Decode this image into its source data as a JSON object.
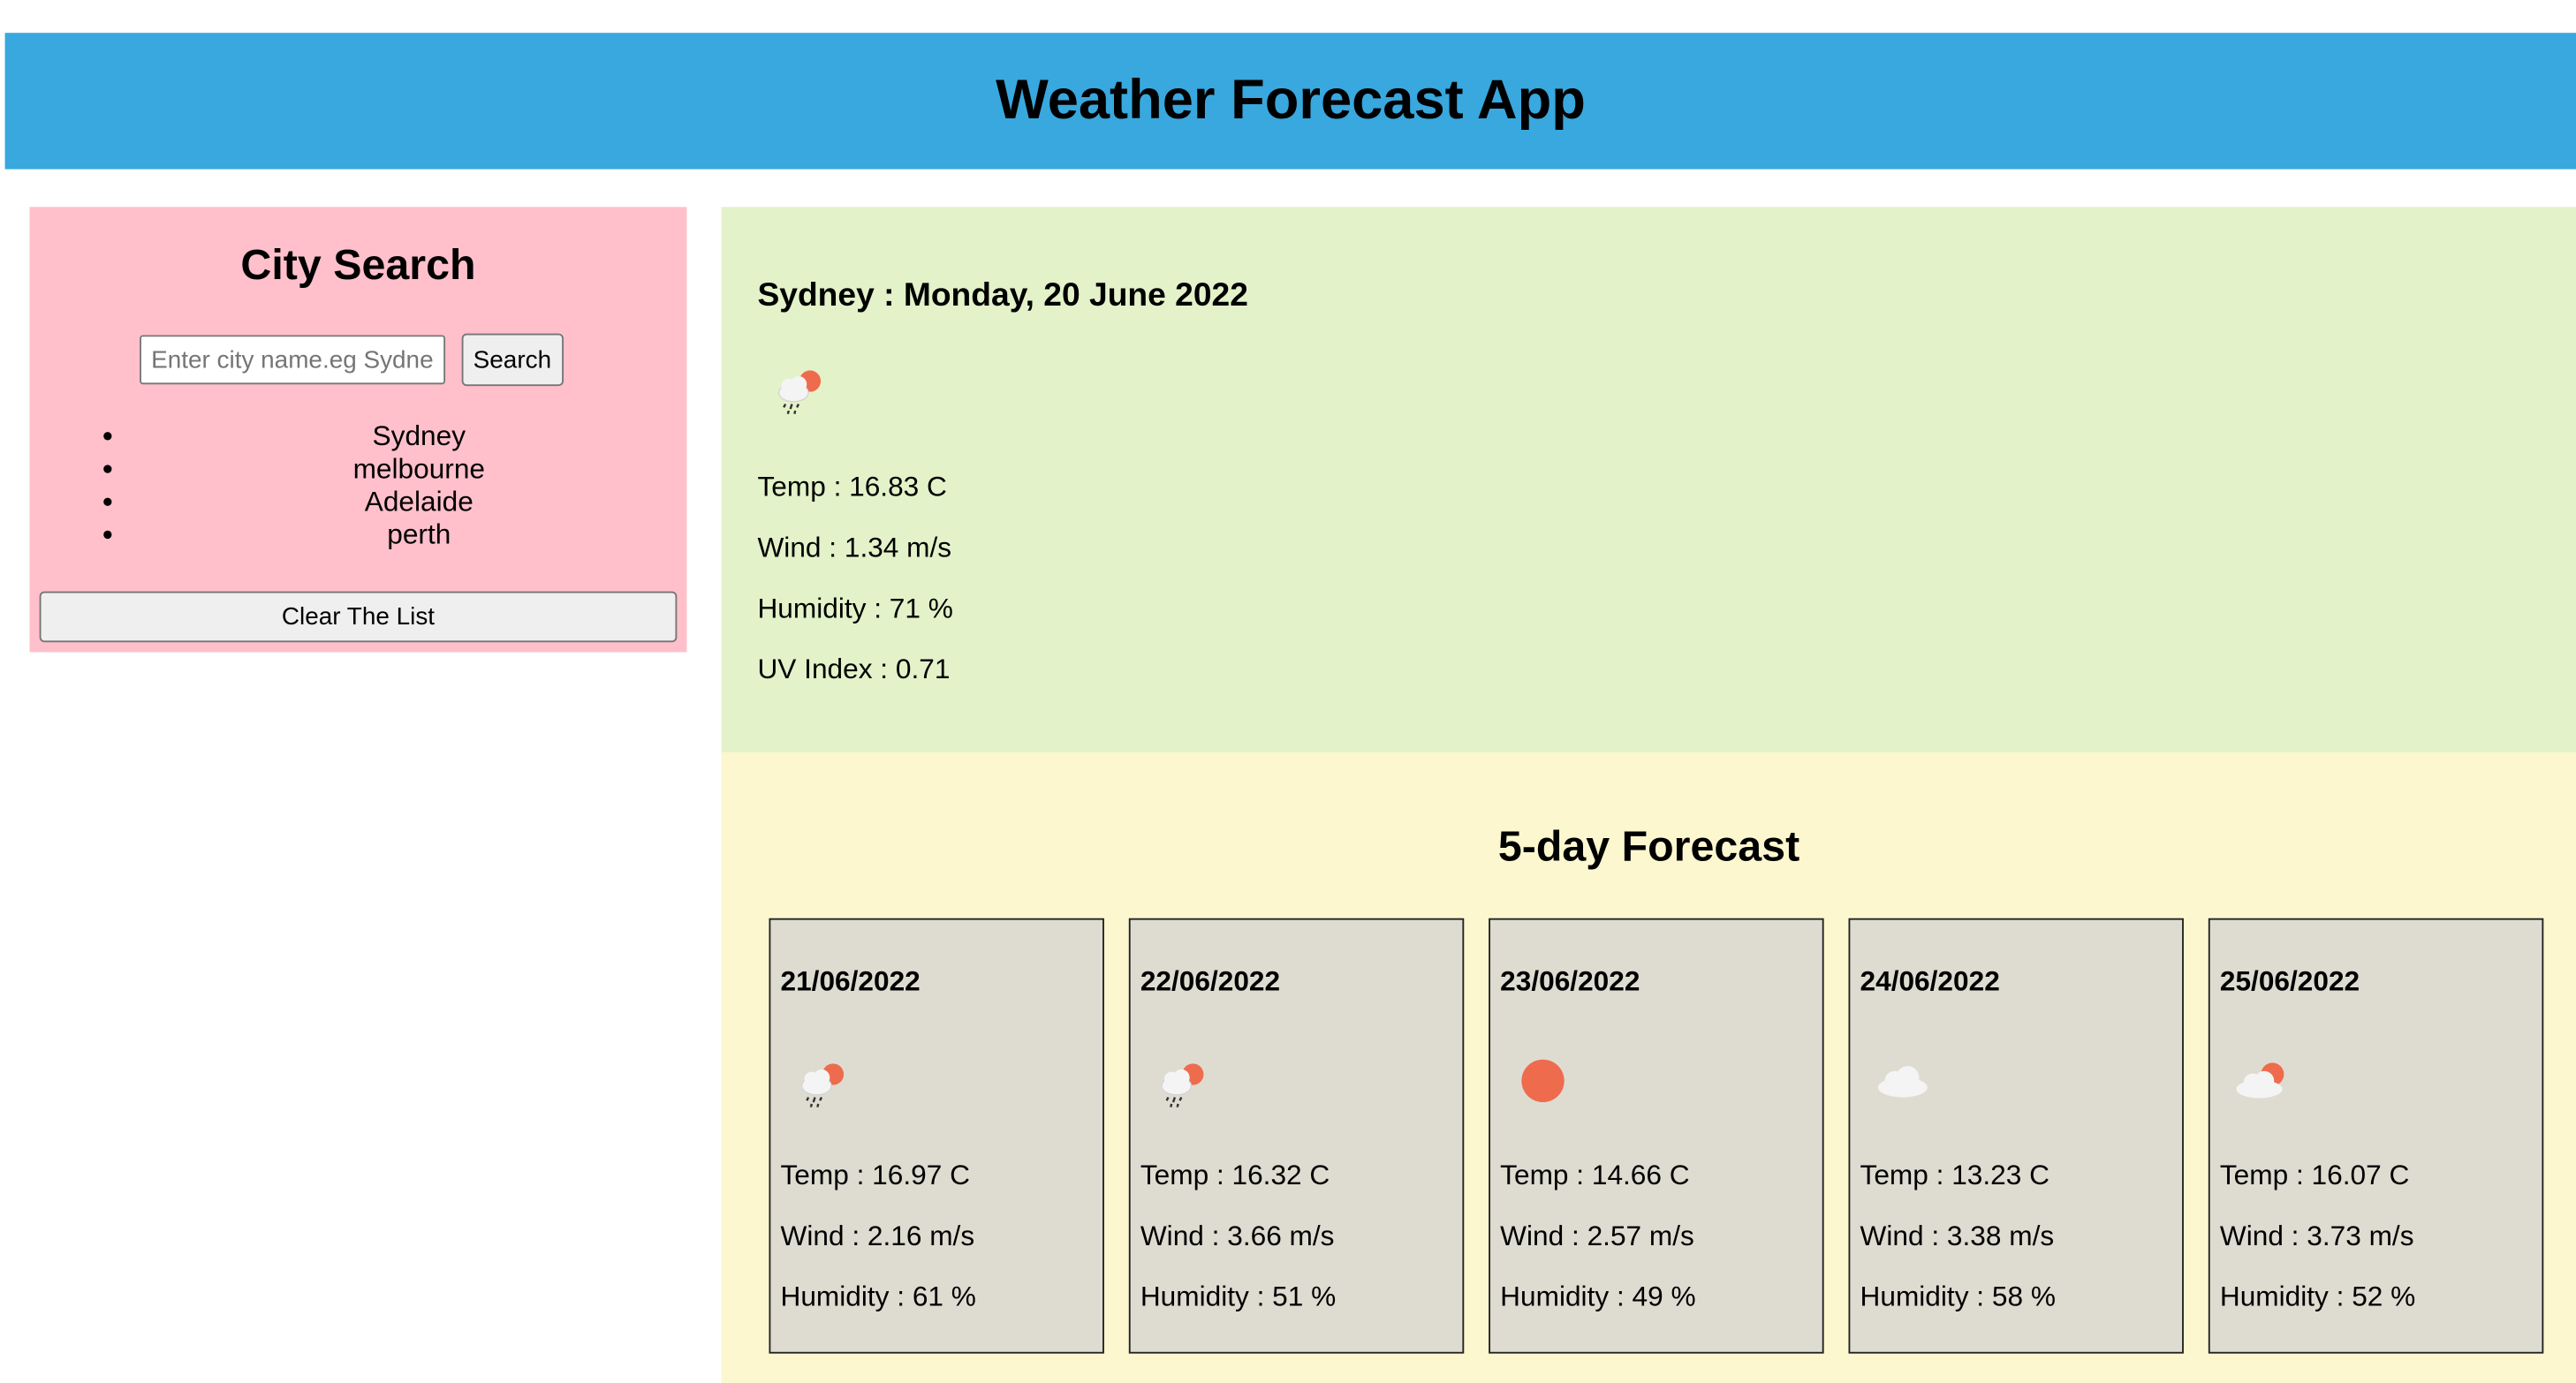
{
  "header": {
    "title": "Weather Forecast App"
  },
  "city_search": {
    "title": "City Search",
    "input_placeholder": "Enter city name.eg Sydney",
    "input_value": "",
    "search_label": "Search",
    "history": [
      "Sydney",
      "melbourne",
      "Adelaide",
      "perth"
    ],
    "clear_label": "Clear The List"
  },
  "current": {
    "title": "Sydney : Monday, 20 June 2022",
    "icon": "rain-sun-icon",
    "temp": "Temp : 16.83 C",
    "wind": "Wind : 1.34 m/s",
    "humidity": "Humidity : 71 %",
    "uv": "UV Index : 0.71"
  },
  "forecast": {
    "title": "5-day Forecast",
    "days": [
      {
        "date": "21/06/2022",
        "icon": "rain-sun-icon",
        "temp": "Temp : 16.97 C",
        "wind": "Wind : 2.16 m/s",
        "humidity": "Humidity : 61 %"
      },
      {
        "date": "22/06/2022",
        "icon": "rain-sun-icon",
        "temp": "Temp : 16.32 C",
        "wind": "Wind : 3.66 m/s",
        "humidity": "Humidity : 51 %"
      },
      {
        "date": "23/06/2022",
        "icon": "sun-icon",
        "temp": "Temp : 14.66 C",
        "wind": "Wind : 2.57 m/s",
        "humidity": "Humidity : 49 %"
      },
      {
        "date": "24/06/2022",
        "icon": "cloud-icon",
        "temp": "Temp : 13.23 C",
        "wind": "Wind : 3.38 m/s",
        "humidity": "Humidity : 58 %"
      },
      {
        "date": "25/06/2022",
        "icon": "cloud-sun-icon",
        "temp": "Temp : 16.07 C",
        "wind": "Wind : 3.73 m/s",
        "humidity": "Humidity : 52 %"
      }
    ]
  },
  "colors": {
    "header_bg": "#38a8df",
    "search_panel_bg": "#ffc0cb",
    "current_panel_bg": "#e3f2c9",
    "forecast_panel_bg": "#fcf7cf",
    "card_bg": "#dedcd1",
    "sun": "#ee6c4d",
    "cloud": "#f4f4f4"
  }
}
